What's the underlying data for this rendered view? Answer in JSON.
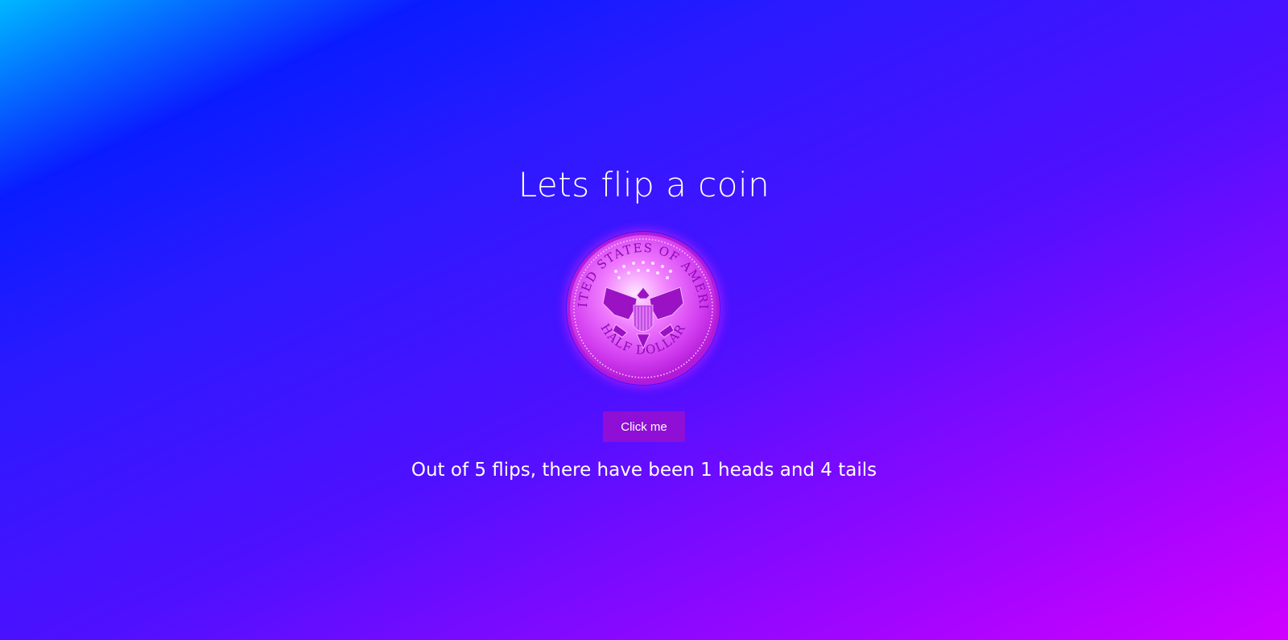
{
  "page": {
    "title": "Lets flip a coin"
  },
  "coin": {
    "icon": "half-dollar-coin-icon",
    "top_inscription": "UNITED STATES OF AMERICA",
    "bottom_inscription": "HALF DOLLAR",
    "face": "tails"
  },
  "controls": {
    "flip_button_label": "Click me"
  },
  "stats": {
    "summary": "Out of 5 flips, there have been 1 heads and 4 tails",
    "total_flips": 5,
    "heads": 1,
    "tails": 4
  },
  "colors": {
    "gradient_start": "#00b8ff",
    "gradient_mid": "#2a1aff",
    "gradient_end": "#d000ff",
    "button_bg": "#8f0fd6",
    "coin_tint": "#e23cf2"
  }
}
